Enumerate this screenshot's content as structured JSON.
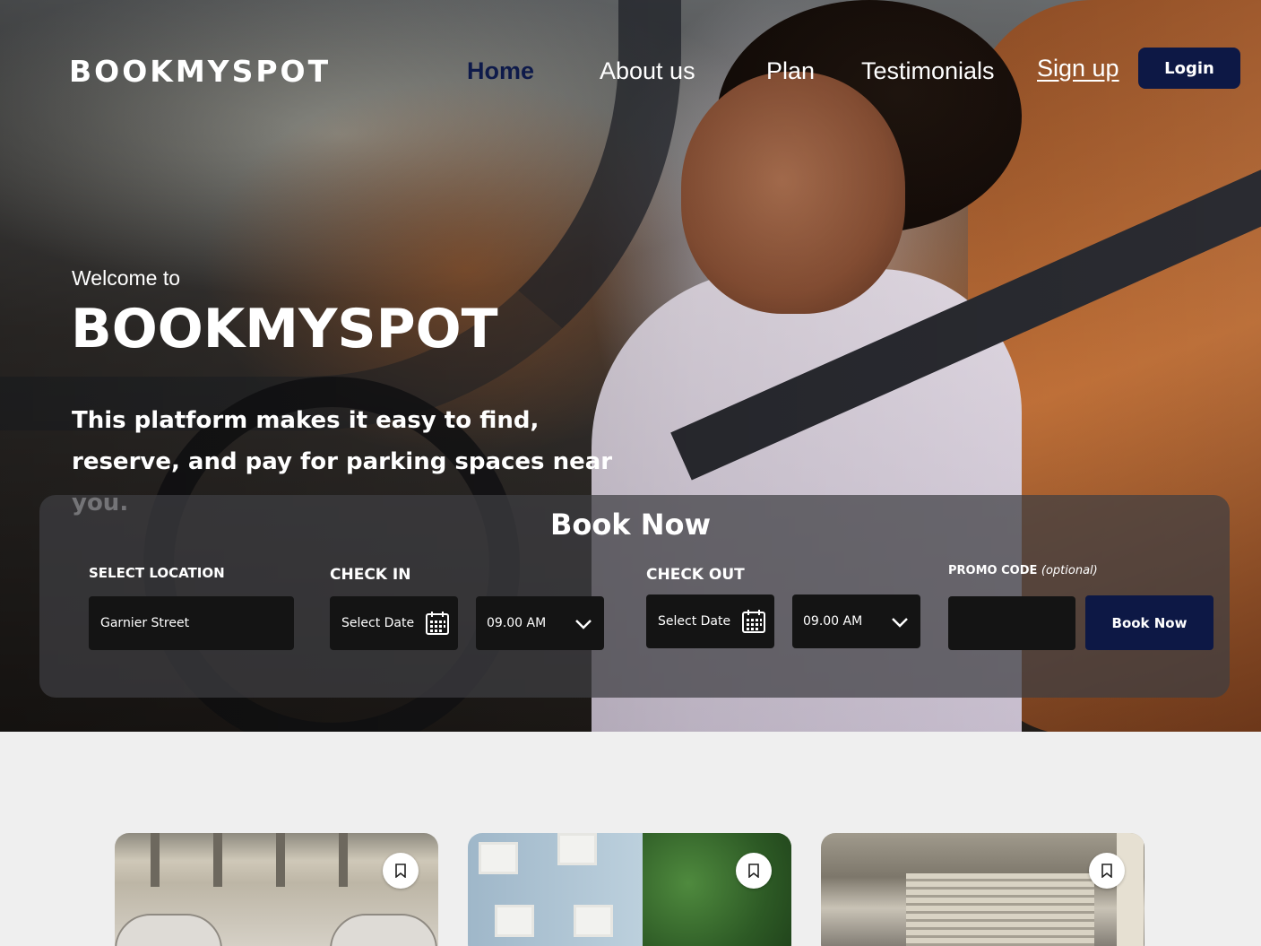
{
  "nav": {
    "logo": "BOOKMYSPOT",
    "links": [
      "Home",
      "About us",
      "Plan",
      "Testimonials"
    ],
    "active": "Home",
    "signup": "Sign up",
    "login": "Login"
  },
  "hero": {
    "welcome": "Welcome to",
    "title": "BOOKMYSPOT",
    "description": "This platform makes it easy to find, reserve, and pay for parking spaces near you."
  },
  "booking": {
    "title": "Book Now",
    "location_label": "SELECT LOCATION",
    "location_value": "Garnier Street",
    "checkin_label": "CHECK IN",
    "checkin_date": "Select Date",
    "checkin_time": "09.00 AM",
    "checkout_label": "CHECK OUT",
    "checkout_date": "Select Date",
    "checkout_time": "09.00 AM",
    "promo_label": "PROMO CODE",
    "promo_optional": "(optional)",
    "promo_value": "",
    "submit": "Book Now"
  },
  "icons": {
    "calendar": "calendar-icon",
    "chevron": "chevron-down-icon",
    "bookmark": "bookmark-icon"
  },
  "colors": {
    "brand_navy": "#0d1845",
    "active_nav": "#0e1a4a",
    "panel": "#3e3e42",
    "field": "#141414",
    "page_bg": "#efefef"
  }
}
